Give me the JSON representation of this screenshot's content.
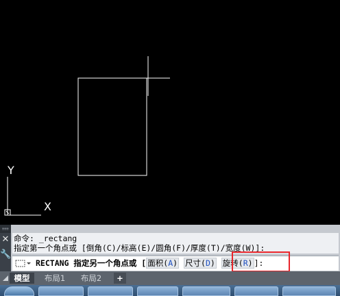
{
  "canvas": {
    "background": "#000000",
    "ucs_y_label": "Y",
    "ucs_x_label": "X"
  },
  "command": {
    "history": [
      "命令: _rectang",
      "指定第一个角点或 [倒角(C)/标高(E)/圆角(F)/厚度(T)/宽度(W)]:"
    ],
    "input_prefix": "RECTANG 指定另一个角点或 [",
    "options": [
      {
        "label": "面积(",
        "key": "A",
        "suffix": ")"
      },
      {
        "label": "尺寸(",
        "key": "D",
        "suffix": ")"
      },
      {
        "label": "旋转(",
        "key": "R",
        "suffix": ")"
      }
    ],
    "input_suffix": "]:",
    "close_icon": "close-icon",
    "customize_icon": "wrench-icon",
    "highlight_color": "#e8252b"
  },
  "layout_tabs": {
    "tabs": [
      "模型",
      "布局1",
      "布局2"
    ],
    "active": "模型",
    "add_label": "+"
  }
}
